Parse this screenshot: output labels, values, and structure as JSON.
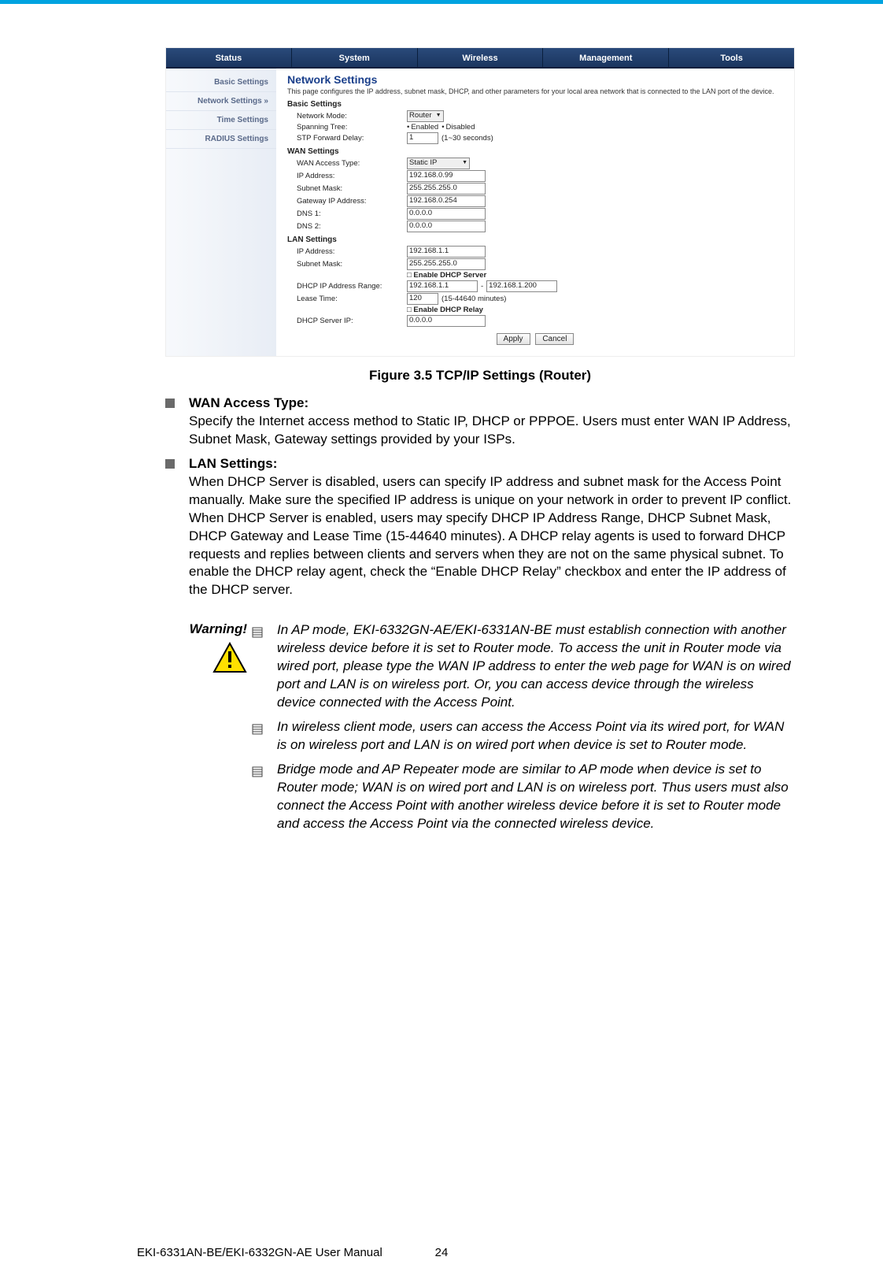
{
  "tabs": [
    "Status",
    "System",
    "Wireless",
    "Management",
    "Tools"
  ],
  "sidenav": {
    "items": [
      {
        "label": "Basic Settings"
      },
      {
        "label": "Network Settings",
        "active": true
      },
      {
        "label": "Time Settings"
      },
      {
        "label": "RADIUS Settings"
      }
    ]
  },
  "panel": {
    "title": "Network Settings",
    "desc": "This page configures the IP address, subnet mask, DHCP, and other parameters for your local area network that is connected to the LAN port of the device.",
    "basic": {
      "heading": "Basic Settings",
      "network_mode_label": "Network Mode:",
      "network_mode_value": "Router",
      "spanning_tree_label": "Spanning Tree:",
      "spanning_enabled": "Enabled",
      "spanning_disabled": "Disabled",
      "stp_label": "STP Forward Delay:",
      "stp_value": "1",
      "stp_hint": "(1~30 seconds)"
    },
    "wan": {
      "heading": "WAN Settings",
      "access_type_label": "WAN Access Type:",
      "access_type_value": "Static IP",
      "ip_label": "IP Address:",
      "ip_value": "192.168.0.99",
      "subnet_label": "Subnet Mask:",
      "subnet_value": "255.255.255.0",
      "gateway_label": "Gateway IP Address:",
      "gateway_value": "192.168.0.254",
      "dns1_label": "DNS 1:",
      "dns1_value": "0.0.0.0",
      "dns2_label": "DNS 2:",
      "dns2_value": "0.0.0.0"
    },
    "lan": {
      "heading": "LAN Settings",
      "ip_label": "IP Address:",
      "ip_value": "192.168.1.1",
      "subnet_label": "Subnet Mask:",
      "subnet_value": "255.255.255.0",
      "enable_dhcp_server": "Enable DHCP Server",
      "range_label": "DHCP IP Address Range:",
      "range_from": "192.168.1.1",
      "range_dash": "-",
      "range_to": "192.168.1.200",
      "lease_label": "Lease Time:",
      "lease_value": "120",
      "lease_hint": "(15-44640 minutes)",
      "enable_dhcp_relay": "Enable DHCP Relay",
      "server_ip_label": "DHCP Server IP:",
      "server_ip_value": "0.0.0.0"
    },
    "buttons": {
      "apply": "Apply",
      "cancel": "Cancel"
    }
  },
  "figure_caption": "Figure 3.5 TCP/IP Settings (Router)",
  "bullets": [
    {
      "title": "WAN Access Type:",
      "text": "Specify the Internet access method to Static IP, DHCP or PPPOE. Users must enter WAN IP Address, Subnet Mask, Gateway settings provided by your ISPs."
    },
    {
      "title": "LAN Settings:",
      "text": "When DHCP Server is disabled, users can specify IP address and subnet mask for the Access Point manually. Make sure the specified IP address is unique on your network in order to prevent IP conflict. When DHCP Server is enabled, users may specify DHCP IP Address Range, DHCP Subnet Mask, DHCP Gateway and Lease Time (15-44640 minutes).  A DHCP relay agents is used to forward DHCP requests and replies between clients and servers when they are not on the same physical subnet.  To enable the DHCP relay agent, check the “Enable DHCP Relay” checkbox and enter the IP address of the DHCP server."
    }
  ],
  "warning": {
    "label": "Warning!",
    "items": [
      "In AP mode, EKI-6332GN-AE/EKI-6331AN-BE must establish connection with another wireless device before it is set to Router mode. To access the unit in Router mode via wired port, please type the WAN IP address to enter the web page for WAN is on wired port and LAN is on wireless port. Or, you can access device through the wireless device connected with the Access Point.",
      "In wireless client mode, users can access the Access Point via its wired port, for WAN is on wireless port and LAN is on wired port when device is set to Router mode.",
      "Bridge mode and AP Repeater mode are similar to AP mode when device is set to Router mode; WAN is on wired port and LAN is on wireless port. Thus users must also connect the Access Point with another wireless device before it is set to Router mode and access the Access Point via the connected wireless device."
    ]
  },
  "footer": {
    "left": "EKI-6331AN-BE/EKI-6332GN-AE User Manual",
    "page": "24"
  }
}
